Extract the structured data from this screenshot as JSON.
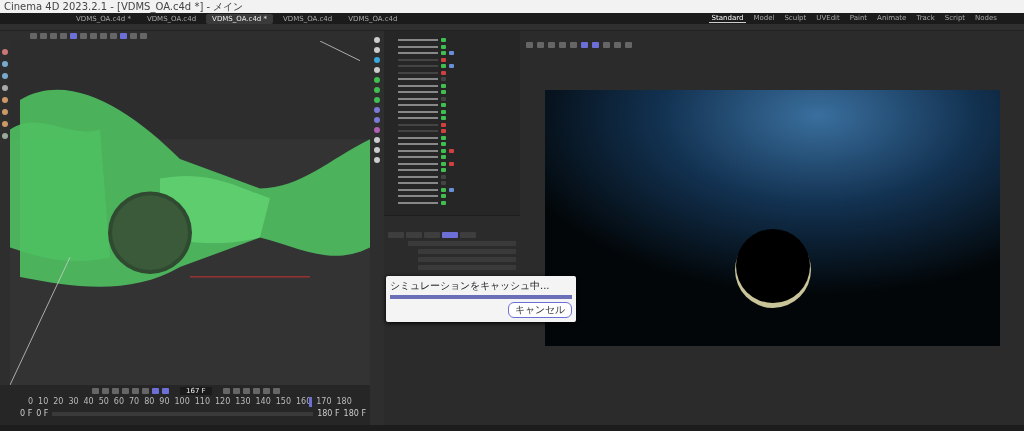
{
  "window": {
    "title": "Cinema 4D 2023.2.1 - [VDMS_OA.c4d *] - メイン"
  },
  "document_tabs": [
    {
      "label": "VDMS_OA.c4d *",
      "selected": false
    },
    {
      "label": "VDMS_OA.c4d",
      "selected": false
    },
    {
      "label": "VDMS_OA.c4d *",
      "selected": true
    },
    {
      "label": "VDMS_OA.c4d",
      "selected": false
    },
    {
      "label": "VDMS_OA.c4d",
      "selected": false
    }
  ],
  "layout_tabs": [
    {
      "label": "Standard",
      "selected": true
    },
    {
      "label": "Model",
      "selected": false
    },
    {
      "label": "Sculpt",
      "selected": false
    },
    {
      "label": "UVEdit",
      "selected": false
    },
    {
      "label": "Paint",
      "selected": false
    },
    {
      "label": "Animate",
      "selected": false
    },
    {
      "label": "Track",
      "selected": false
    },
    {
      "label": "Script",
      "selected": false
    },
    {
      "label": "Nodes",
      "selected": false
    }
  ],
  "timeline": {
    "frame": "167 F",
    "ticks": [
      "0",
      "10",
      "20",
      "30",
      "40",
      "50",
      "60",
      "70",
      "80",
      "90",
      "100",
      "110",
      "120",
      "130",
      "140",
      "150",
      "160",
      "170",
      "180"
    ],
    "level": 0.88,
    "start": "0 F",
    "start_min": "0 F",
    "end": "180 F",
    "end_max": "180 F"
  },
  "object_rows": [
    {
      "kind": "check",
      "enabled": true
    },
    {
      "kind": "check",
      "enabled": true
    },
    {
      "kind": "tags",
      "enabled": true
    },
    {
      "kind": "cross",
      "enabled": false
    },
    {
      "kind": "tags",
      "enabled": false
    },
    {
      "kind": "cross",
      "enabled": false
    },
    {
      "kind": "none",
      "enabled": true
    },
    {
      "kind": "check",
      "enabled": true
    },
    {
      "kind": "check",
      "enabled": true
    },
    {
      "kind": "none",
      "enabled": true
    },
    {
      "kind": "check",
      "enabled": true
    },
    {
      "kind": "check",
      "enabled": true
    },
    {
      "kind": "check",
      "enabled": true
    },
    {
      "kind": "cross",
      "enabled": false
    },
    {
      "kind": "cross",
      "enabled": false
    },
    {
      "kind": "check",
      "enabled": true
    },
    {
      "kind": "check",
      "enabled": true
    },
    {
      "kind": "stop",
      "enabled": true
    },
    {
      "kind": "check",
      "enabled": true
    },
    {
      "kind": "stop",
      "enabled": true
    },
    {
      "kind": "check",
      "enabled": true
    },
    {
      "kind": "none",
      "enabled": true
    },
    {
      "kind": "none",
      "enabled": true
    },
    {
      "kind": "tags",
      "enabled": true
    },
    {
      "kind": "check",
      "enabled": true
    },
    {
      "kind": "check",
      "enabled": true
    }
  ],
  "attribute_tabs": [
    {
      "selected": false
    },
    {
      "selected": false
    },
    {
      "selected": false
    },
    {
      "selected": true
    },
    {
      "selected": false
    }
  ],
  "dialog": {
    "message": "シミュレーションをキャッシュ中...",
    "level": 1,
    "button": "キャンセル"
  }
}
